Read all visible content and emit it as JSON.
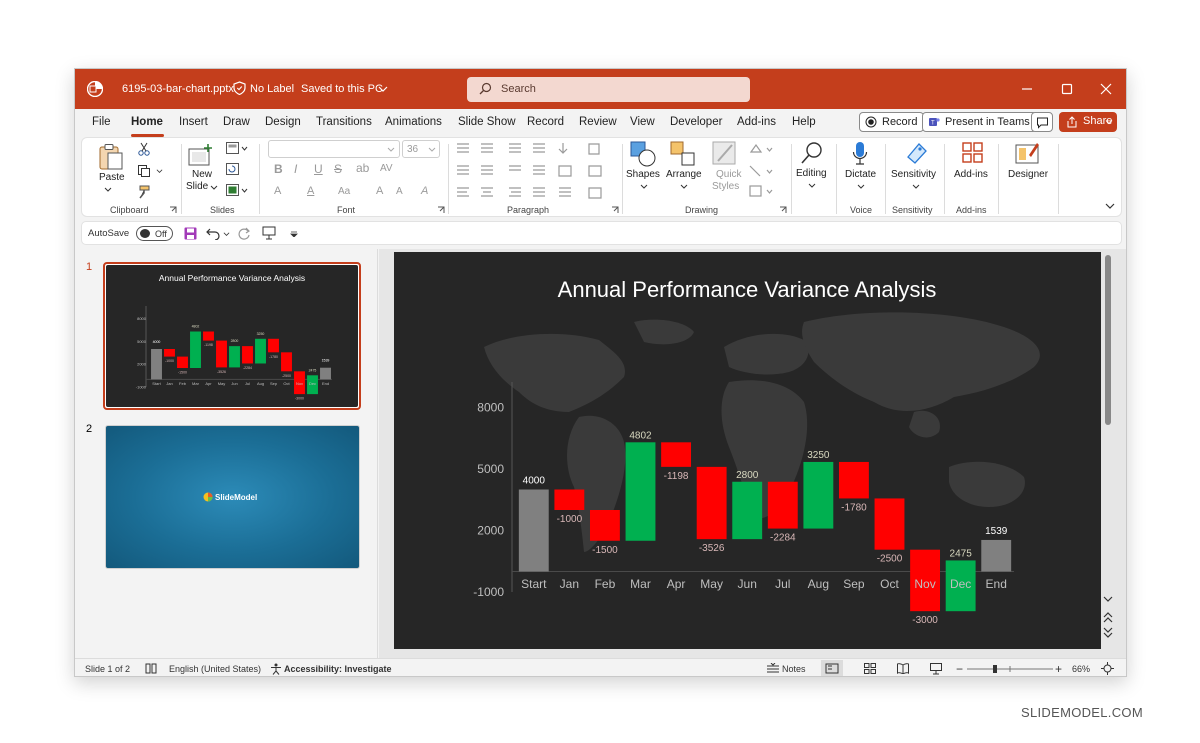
{
  "window": {
    "file_name": "6195-03-bar-chart.pptx",
    "label_status": "No Label",
    "save_status": "Saved to this PC",
    "search_placeholder": "Search"
  },
  "tabs": [
    "File",
    "Home",
    "Insert",
    "Draw",
    "Design",
    "Transitions",
    "Animations",
    "Slide Show",
    "Record",
    "Review",
    "View",
    "Developer",
    "Add-ins",
    "Help"
  ],
  "active_tab": "Home",
  "right_buttons": {
    "record": "Record",
    "present": "Present in Teams",
    "share": "Share"
  },
  "ribbon": {
    "clipboard": {
      "paste": "Paste",
      "group": "Clipboard"
    },
    "slides": {
      "new": "New",
      "slide": "Slide",
      "group": "Slides"
    },
    "font": {
      "size": "36",
      "group": "Font"
    },
    "paragraph": {
      "group": "Paragraph"
    },
    "drawing": {
      "shapes": "Shapes",
      "arrange": "Arrange",
      "quick": "Quick",
      "styles": "Styles",
      "group": "Drawing"
    },
    "editing": {
      "label": "Editing"
    },
    "voice": {
      "dictate": "Dictate",
      "group": "Voice"
    },
    "sensitivity": {
      "label": "Sensitivity",
      "group": "Sensitivity"
    },
    "addins": {
      "label": "Add-ins",
      "group": "Add-ins"
    },
    "designer": {
      "label": "Designer"
    }
  },
  "qat": {
    "autosave": "AutoSave",
    "autosave_state": "Off"
  },
  "thumbnails": {
    "slide1_num": "1",
    "slide2_num": "2",
    "slide1_title": "Annual Performance Variance Analysis",
    "slide2_logo": "SlideModel"
  },
  "statusbar": {
    "slide": "Slide 1 of 2",
    "language": "English (United States)",
    "accessibility": "Accessibility: Investigate",
    "notes": "Notes",
    "zoom": "66%"
  },
  "watermark": "SLIDEMODEL.COM",
  "colors": {
    "accent": "#c43e1c",
    "increase": "#00b050",
    "decrease": "#ff0000",
    "total": "#808080"
  },
  "chart_data": {
    "type": "bar",
    "subtype": "waterfall",
    "title": "Annual Performance Variance Analysis",
    "categories": [
      "Start",
      "Jan",
      "Feb",
      "Mar",
      "Apr",
      "May",
      "Jun",
      "Jul",
      "Aug",
      "Sep",
      "Oct",
      "Nov",
      "Dec",
      "End"
    ],
    "values": [
      4000,
      -1000,
      -1500,
      4802,
      -1198,
      -3526,
      2800,
      -2284,
      3250,
      -1780,
      -2500,
      -3000,
      2475,
      1539
    ],
    "labels": [
      "4000",
      "-1000",
      "-1500",
      "4802",
      "-1198",
      "-3526",
      "2800",
      "-2284",
      "3250",
      "-1780",
      "-2500",
      "-3000",
      "2475",
      "1539"
    ],
    "kinds": [
      "total",
      "dec",
      "dec",
      "inc",
      "dec",
      "dec",
      "inc",
      "dec",
      "inc",
      "dec",
      "dec",
      "dec",
      "inc",
      "total"
    ],
    "yticks": [
      -1000,
      2000,
      5000,
      8000
    ],
    "ylim": [
      -1000,
      9000
    ],
    "grid": false,
    "legend": "none"
  }
}
